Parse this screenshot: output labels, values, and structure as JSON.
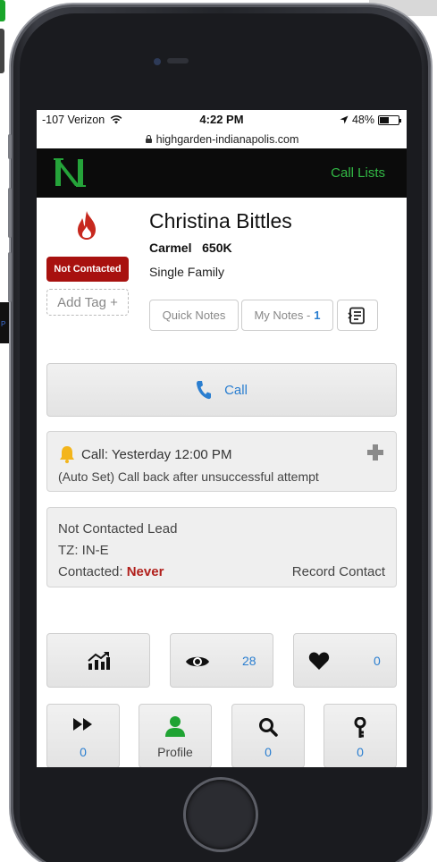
{
  "status_bar": {
    "carrier": "-107 Verizon",
    "time": "4:22 PM",
    "battery": "48%",
    "battery_level": 0.48
  },
  "browser": {
    "url": "highgarden-indianapolis.com"
  },
  "header": {
    "call_lists_label": "Call Lists"
  },
  "lead": {
    "name": "Christina Bittles",
    "city": "Carmel",
    "price": "650K",
    "property_type": "Single Family",
    "status_badge": "Not Contacted",
    "add_tag_label": "Add Tag +"
  },
  "notes": {
    "quick_notes_label": "Quick Notes",
    "my_notes_label": "My Notes -",
    "my_notes_count": "1"
  },
  "call_button": {
    "label": "Call"
  },
  "reminder": {
    "title": "Call: Yesterday 12:00 PM",
    "detail": "(Auto Set)  Call back after unsuccessful attempt"
  },
  "lead_status": {
    "line1": "Not Contacted Lead",
    "timezone": "TZ: IN-E",
    "contacted_label": "Contacted:",
    "contacted_value": "Never",
    "record_contact_label": "Record Contact"
  },
  "stats": {
    "views_count": "28",
    "favorites_count": "0"
  },
  "bottom_nav": {
    "skip_count": "0",
    "profile_label": "Profile",
    "search_count": "0",
    "keys_count": "0"
  },
  "colors": {
    "accent_green": "#32b945",
    "link_blue": "#2a7ed0",
    "badge_red": "#a8110f",
    "never_red": "#b1201c"
  }
}
